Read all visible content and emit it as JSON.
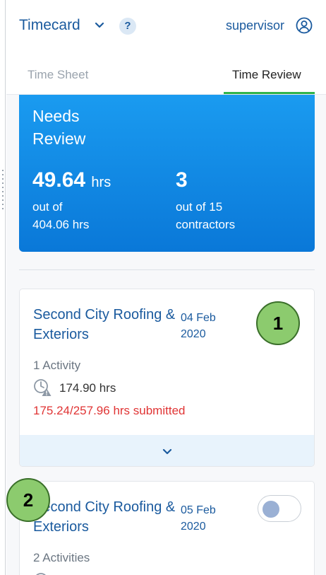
{
  "header": {
    "app_title": "Timecard",
    "help_label": "?",
    "user_label": "supervisor",
    "brand_color": "#1a5a9e"
  },
  "tabs": [
    {
      "label": "Time Sheet",
      "active": false
    },
    {
      "label": "Time Review",
      "active": true
    }
  ],
  "summary": {
    "title": "Needs Review",
    "hours_value": "49.64",
    "hours_unit": "hrs",
    "hours_sub_line1": "out of",
    "hours_sub_line2": "404.06 hrs",
    "contractors_value": "3",
    "contractors_sub_line1": "out of 15",
    "contractors_sub_line2": "contractors",
    "colors": {
      "top": "#1a9bf0",
      "bottom": "#0a78d8"
    }
  },
  "cards": [
    {
      "company": "Second City Roofing & Exteriors",
      "date_line1": "04 Feb",
      "date_line2": "2020",
      "activities": "1 Activity",
      "hours": "174.90 hrs",
      "submitted": "175.24/257.96 hrs submitted",
      "icons": [
        "clock-warning-icon",
        "chevron-down-icon"
      ]
    },
    {
      "company": "Second City Roofing & Exteriors",
      "date_line1": "05 Feb",
      "date_line2": "2020",
      "activities": "2 Activities",
      "toggle_on": false
    }
  ],
  "annotations": [
    {
      "label": "1",
      "color": "#8ccb6e"
    },
    {
      "label": "2",
      "color": "#8ccb6e"
    }
  ],
  "status_colors": {
    "submitted": "#e03434",
    "tab_underline": "#2fb34a"
  }
}
